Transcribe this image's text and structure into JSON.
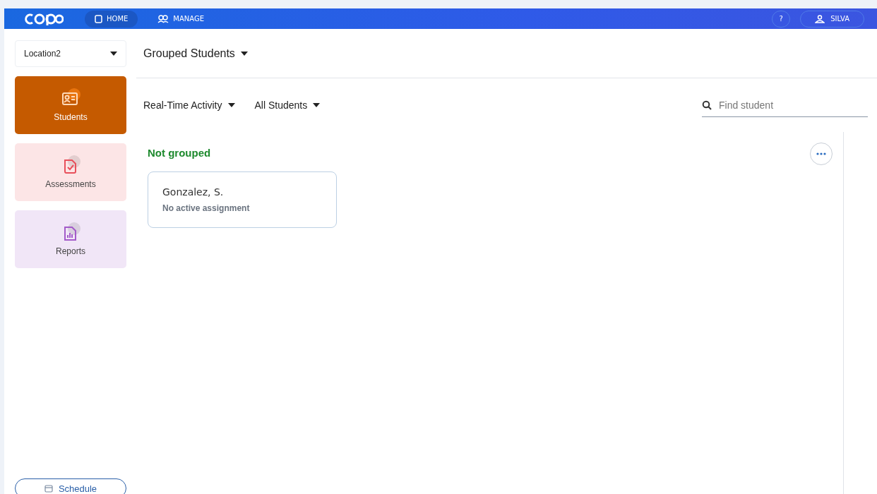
{
  "header": {
    "nav": [
      {
        "label": "HOME",
        "selected": true
      },
      {
        "label": "MANAGE",
        "selected": false
      }
    ],
    "help": "?",
    "user": "SILVA"
  },
  "sidebar": {
    "location": "Location2",
    "items": [
      {
        "label": "Students",
        "selected": true,
        "color": "#c55a00"
      },
      {
        "label": "Assessments",
        "selected": false,
        "color": "#e8505b"
      },
      {
        "label": "Reports",
        "selected": false,
        "color": "#a35bc9"
      }
    ],
    "schedule": "Schedule"
  },
  "main": {
    "title": "Grouped Students",
    "filters": [
      "Real-Time Activity",
      "All Students"
    ],
    "search": {
      "placeholder": "Find student"
    },
    "groups": [
      {
        "name": "Not grouped",
        "students": [
          {
            "name": "Gonzalez, S.",
            "status": "No active assignment"
          }
        ]
      }
    ]
  }
}
